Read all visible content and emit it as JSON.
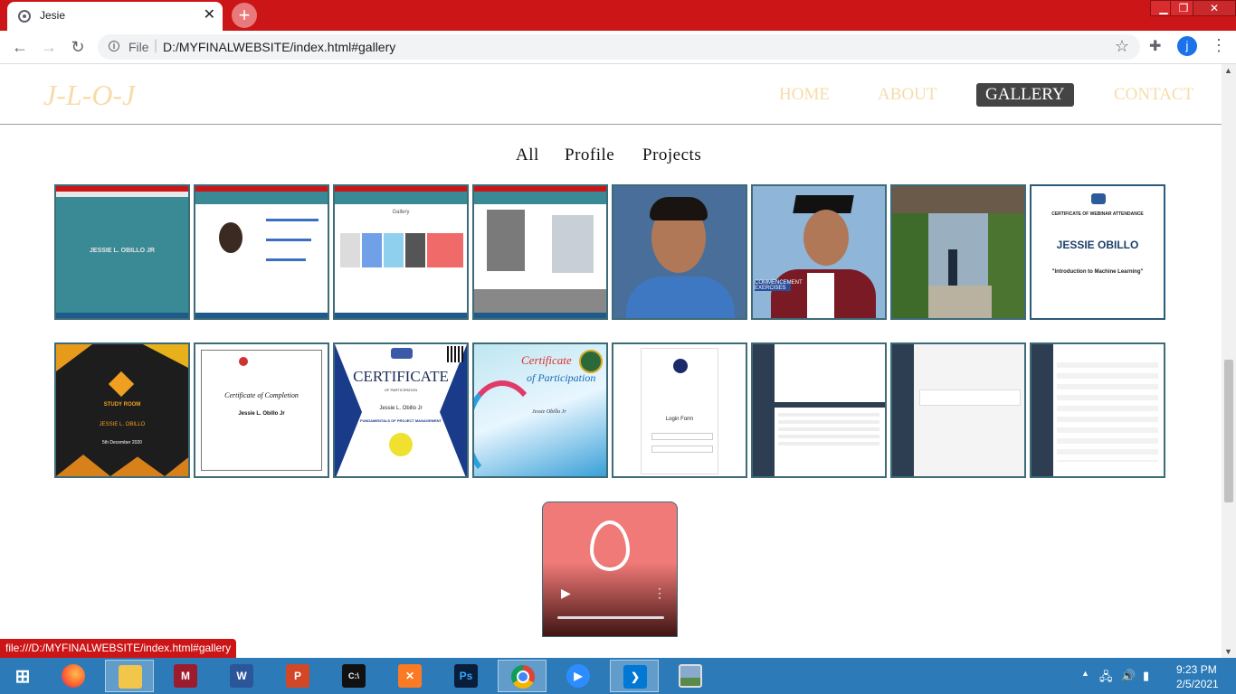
{
  "browser": {
    "tab_title": "Jesie",
    "tab_close": "✕",
    "new_tab": "+",
    "win_min": "▁",
    "win_restore": "❐",
    "win_close": "✕",
    "url_scheme": "File",
    "url": "D:/MYFINALWEBSITE/index.html#gallery",
    "profile_initial": "j",
    "status_url": "file:///D:/MYFINALWEBSITE/index.html#gallery"
  },
  "site": {
    "logo": "J-L-O-J",
    "nav": [
      "HOME",
      "ABOUT",
      "GALLERY",
      "CONTACT"
    ],
    "active_nav": "GALLERY",
    "filters": [
      "All",
      "Profile",
      "Projects"
    ],
    "accent_color": "#f6dcaa",
    "gallery_row1": [
      {
        "kind": "website-screenshot",
        "text": "JESSIE L. OBILLO JR"
      },
      {
        "kind": "website-screenshot",
        "text": ""
      },
      {
        "kind": "website-screenshot",
        "text": "Gallery"
      },
      {
        "kind": "website-screenshot",
        "text": ""
      },
      {
        "kind": "photo-portrait",
        "text": ""
      },
      {
        "kind": "photo-graduation",
        "text": "COMMENCEMENT EXERCISES"
      },
      {
        "kind": "photo-garden",
        "text": ""
      },
      {
        "kind": "certificate-webinar",
        "title": "CERTIFICATE OF WEBINAR ATTENDANCE",
        "name": "JESSIE OBILLO",
        "course": "\"Introduction to Machine Learning\""
      }
    ],
    "gallery_row2": [
      {
        "kind": "certificate-studyroom",
        "title": "STUDY ROOM",
        "name": "JESSIE L. OBILLO",
        "date": "5th December 2020"
      },
      {
        "kind": "certificate-completion",
        "title": "Certificate of Completion",
        "name": "Jessie L. Obillo Jr"
      },
      {
        "kind": "certificate-participation",
        "title": "CERTIFICATE",
        "subtitle": "OF PARTICIPATION",
        "name": "Jessie L. Obillo Jr",
        "course": "FUNDAMENTALS OF PROJECT MANAGEMENT"
      },
      {
        "kind": "certificate-colorful",
        "title": "Certificate",
        "subtitle": "of Participation",
        "name": "Jessie Obillo Jr"
      },
      {
        "kind": "login-form",
        "title": "Login Form"
      },
      {
        "kind": "dashboard-screenshot",
        "text": ""
      },
      {
        "kind": "dashboard-screenshot",
        "text": ""
      },
      {
        "kind": "dashboard-screenshot",
        "text": ""
      }
    ],
    "video": {
      "icon": "flame-icon",
      "play": "▶",
      "menu": "⋮"
    }
  },
  "taskbar": {
    "apps": [
      "windows-start",
      "firefox",
      "file-explorer",
      "mendeley",
      "word",
      "powerpoint",
      "cmd",
      "xampp",
      "photoshop",
      "chrome",
      "zoom",
      "vscode",
      "photos"
    ],
    "active": [
      "file-explorer",
      "chrome",
      "vscode"
    ],
    "time": "9:23 PM",
    "date": "2/5/2021"
  }
}
